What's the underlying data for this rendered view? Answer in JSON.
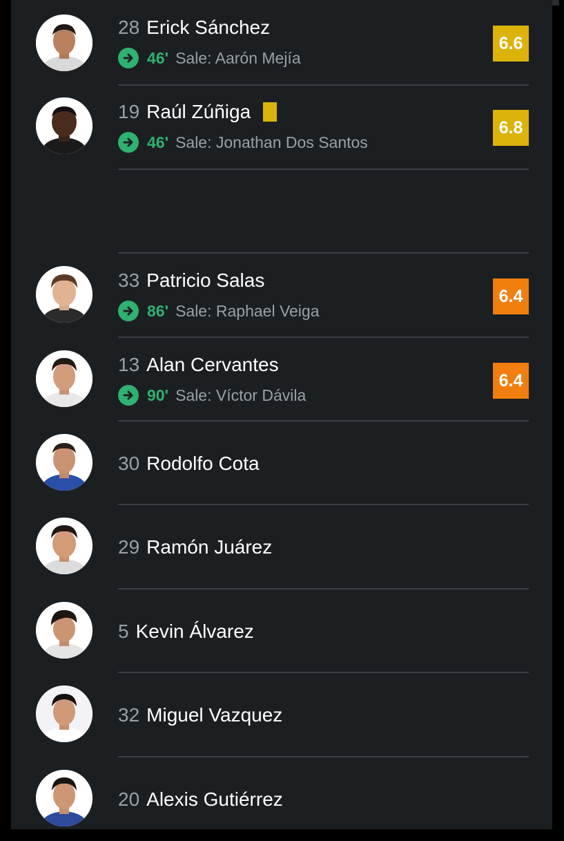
{
  "players": [
    {
      "number": "28",
      "name": "Erick Sánchez",
      "yellow_card": false,
      "sub_minute": "46'",
      "sub_label": "Sale: Aarón Mejía",
      "rating": "6.6",
      "rating_color": "#dcb30a",
      "avatar_icon": "player-photo"
    },
    {
      "number": "19",
      "name": "Raúl Zúñiga",
      "yellow_card": true,
      "sub_minute": "46'",
      "sub_label": "Sale: Jonathan Dos Santos",
      "rating": "6.8",
      "rating_color": "#dcb30a",
      "avatar_icon": "player-photo"
    },
    {
      "number": "33",
      "name": "Patricio Salas",
      "yellow_card": false,
      "sub_minute": "86'",
      "sub_label": "Sale: Raphael Veiga",
      "rating": "6.4",
      "rating_color": "#f07f0f",
      "avatar_icon": "player-photo"
    },
    {
      "number": "13",
      "name": "Alan Cervantes",
      "yellow_card": false,
      "sub_minute": "90'",
      "sub_label": "Sale: Víctor Dávila",
      "rating": "6.4",
      "rating_color": "#f07f0f",
      "avatar_icon": "player-photo"
    },
    {
      "number": "30",
      "name": "Rodolfo Cota",
      "avatar_icon": "player-photo"
    },
    {
      "number": "29",
      "name": "Ramón Juárez",
      "avatar_icon": "player-photo"
    },
    {
      "number": "5",
      "name": "Kevin Álvarez",
      "avatar_icon": "player-photo"
    },
    {
      "number": "32",
      "name": "Miguel Vazquez",
      "avatar_icon": "player-photo"
    },
    {
      "number": "20",
      "name": "Alexis Gutiérrez",
      "avatar_icon": "player-photo"
    }
  ],
  "icons": {
    "substitution": "arrow-right-circle-icon",
    "card": "yellow-card-icon"
  },
  "colors": {
    "panel_background": "#1c1f22",
    "sub_green": "#2fb170",
    "rating_yellow": "#dcb30a",
    "rating_orange": "#f07f0f"
  }
}
